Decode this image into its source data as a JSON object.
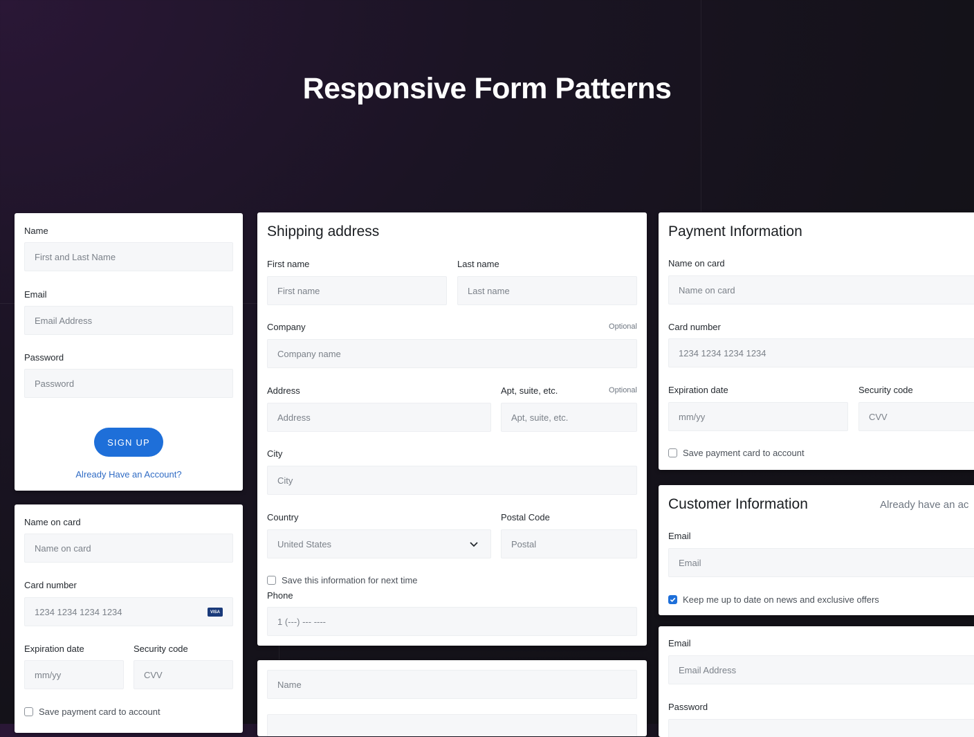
{
  "hero": {
    "title": "Responsive Form Patterns"
  },
  "signup": {
    "name_label": "Name",
    "name_placeholder": "First and Last Name",
    "email_label": "Email",
    "email_placeholder": "Email Address",
    "password_label": "Password",
    "password_placeholder": "Password",
    "submit_label": "SIGN UP",
    "login_link": "Already Have an Account?"
  },
  "card_left": {
    "name_label": "Name on card",
    "name_placeholder": "Name on card",
    "number_label": "Card number",
    "number_placeholder": "1234 1234 1234 1234",
    "card_brand": "VISA",
    "exp_label": "Expiration date",
    "exp_placeholder": "mm/yy",
    "cvv_label": "Security code",
    "cvv_placeholder": "CVV",
    "save_label": "Save payment card to account"
  },
  "shipping": {
    "title": "Shipping address",
    "first_label": "First name",
    "first_placeholder": "First name",
    "last_label": "Last name",
    "last_placeholder": "Last name",
    "company_label": "Company",
    "company_optional": "Optional",
    "company_placeholder": "Company name",
    "address_label": "Address",
    "address_placeholder": "Address",
    "apt_label": "Apt, suite, etc.",
    "apt_optional": "Optional",
    "apt_placeholder": "Apt, suite, etc.",
    "city_label": "City",
    "city_placeholder": "City",
    "country_label": "Country",
    "country_value": "United States",
    "postal_label": "Postal Code",
    "postal_placeholder": "Postal",
    "save_label": "Save this information for next time",
    "phone_label": "Phone",
    "phone_placeholder": "1 (---) --- ----"
  },
  "bottom_mid": {
    "name_placeholder": "Name"
  },
  "payment": {
    "title": "Payment Information",
    "name_label": "Name on card",
    "name_placeholder": "Name on card",
    "number_label": "Card number",
    "number_placeholder": "1234 1234 1234 1234",
    "exp_label": "Expiration date",
    "exp_placeholder": "mm/yy",
    "cvv_label": "Security code",
    "cvv_placeholder": "CVV",
    "save_label": "Save payment card to account"
  },
  "customer": {
    "title": "Customer Information",
    "login_link": "Already have an ac",
    "email_label": "Email",
    "email_placeholder": "Email",
    "news_label": "Keep me up to date on news and exclusive offers"
  },
  "login_right": {
    "email_label": "Email",
    "email_placeholder": "Email Address",
    "password_label": "Password"
  },
  "colors": {
    "accent": "#1e6fd9",
    "link": "#2f6bc4",
    "field_bg": "#f6f7f9"
  }
}
